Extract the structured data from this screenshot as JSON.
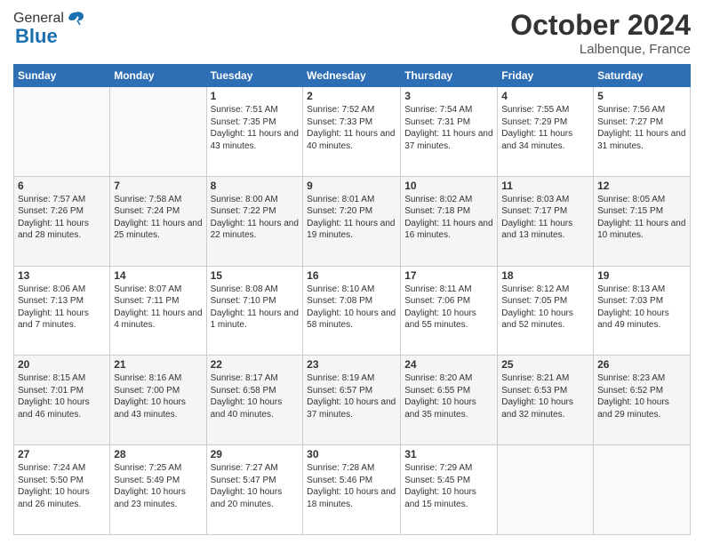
{
  "header": {
    "logo_general": "General",
    "logo_blue": "Blue",
    "month_title": "October 2024",
    "location": "Lalbenque, France"
  },
  "weekdays": [
    "Sunday",
    "Monday",
    "Tuesday",
    "Wednesday",
    "Thursday",
    "Friday",
    "Saturday"
  ],
  "weeks": [
    [
      {
        "day": "",
        "content": ""
      },
      {
        "day": "",
        "content": ""
      },
      {
        "day": "1",
        "content": "Sunrise: 7:51 AM\nSunset: 7:35 PM\nDaylight: 11 hours and 43 minutes."
      },
      {
        "day": "2",
        "content": "Sunrise: 7:52 AM\nSunset: 7:33 PM\nDaylight: 11 hours and 40 minutes."
      },
      {
        "day": "3",
        "content": "Sunrise: 7:54 AM\nSunset: 7:31 PM\nDaylight: 11 hours and 37 minutes."
      },
      {
        "day": "4",
        "content": "Sunrise: 7:55 AM\nSunset: 7:29 PM\nDaylight: 11 hours and 34 minutes."
      },
      {
        "day": "5",
        "content": "Sunrise: 7:56 AM\nSunset: 7:27 PM\nDaylight: 11 hours and 31 minutes."
      }
    ],
    [
      {
        "day": "6",
        "content": "Sunrise: 7:57 AM\nSunset: 7:26 PM\nDaylight: 11 hours and 28 minutes."
      },
      {
        "day": "7",
        "content": "Sunrise: 7:58 AM\nSunset: 7:24 PM\nDaylight: 11 hours and 25 minutes."
      },
      {
        "day": "8",
        "content": "Sunrise: 8:00 AM\nSunset: 7:22 PM\nDaylight: 11 hours and 22 minutes."
      },
      {
        "day": "9",
        "content": "Sunrise: 8:01 AM\nSunset: 7:20 PM\nDaylight: 11 hours and 19 minutes."
      },
      {
        "day": "10",
        "content": "Sunrise: 8:02 AM\nSunset: 7:18 PM\nDaylight: 11 hours and 16 minutes."
      },
      {
        "day": "11",
        "content": "Sunrise: 8:03 AM\nSunset: 7:17 PM\nDaylight: 11 hours and 13 minutes."
      },
      {
        "day": "12",
        "content": "Sunrise: 8:05 AM\nSunset: 7:15 PM\nDaylight: 11 hours and 10 minutes."
      }
    ],
    [
      {
        "day": "13",
        "content": "Sunrise: 8:06 AM\nSunset: 7:13 PM\nDaylight: 11 hours and 7 minutes."
      },
      {
        "day": "14",
        "content": "Sunrise: 8:07 AM\nSunset: 7:11 PM\nDaylight: 11 hours and 4 minutes."
      },
      {
        "day": "15",
        "content": "Sunrise: 8:08 AM\nSunset: 7:10 PM\nDaylight: 11 hours and 1 minute."
      },
      {
        "day": "16",
        "content": "Sunrise: 8:10 AM\nSunset: 7:08 PM\nDaylight: 10 hours and 58 minutes."
      },
      {
        "day": "17",
        "content": "Sunrise: 8:11 AM\nSunset: 7:06 PM\nDaylight: 10 hours and 55 minutes."
      },
      {
        "day": "18",
        "content": "Sunrise: 8:12 AM\nSunset: 7:05 PM\nDaylight: 10 hours and 52 minutes."
      },
      {
        "day": "19",
        "content": "Sunrise: 8:13 AM\nSunset: 7:03 PM\nDaylight: 10 hours and 49 minutes."
      }
    ],
    [
      {
        "day": "20",
        "content": "Sunrise: 8:15 AM\nSunset: 7:01 PM\nDaylight: 10 hours and 46 minutes."
      },
      {
        "day": "21",
        "content": "Sunrise: 8:16 AM\nSunset: 7:00 PM\nDaylight: 10 hours and 43 minutes."
      },
      {
        "day": "22",
        "content": "Sunrise: 8:17 AM\nSunset: 6:58 PM\nDaylight: 10 hours and 40 minutes."
      },
      {
        "day": "23",
        "content": "Sunrise: 8:19 AM\nSunset: 6:57 PM\nDaylight: 10 hours and 37 minutes."
      },
      {
        "day": "24",
        "content": "Sunrise: 8:20 AM\nSunset: 6:55 PM\nDaylight: 10 hours and 35 minutes."
      },
      {
        "day": "25",
        "content": "Sunrise: 8:21 AM\nSunset: 6:53 PM\nDaylight: 10 hours and 32 minutes."
      },
      {
        "day": "26",
        "content": "Sunrise: 8:23 AM\nSunset: 6:52 PM\nDaylight: 10 hours and 29 minutes."
      }
    ],
    [
      {
        "day": "27",
        "content": "Sunrise: 7:24 AM\nSunset: 5:50 PM\nDaylight: 10 hours and 26 minutes."
      },
      {
        "day": "28",
        "content": "Sunrise: 7:25 AM\nSunset: 5:49 PM\nDaylight: 10 hours and 23 minutes."
      },
      {
        "day": "29",
        "content": "Sunrise: 7:27 AM\nSunset: 5:47 PM\nDaylight: 10 hours and 20 minutes."
      },
      {
        "day": "30",
        "content": "Sunrise: 7:28 AM\nSunset: 5:46 PM\nDaylight: 10 hours and 18 minutes."
      },
      {
        "day": "31",
        "content": "Sunrise: 7:29 AM\nSunset: 5:45 PM\nDaylight: 10 hours and 15 minutes."
      },
      {
        "day": "",
        "content": ""
      },
      {
        "day": "",
        "content": ""
      }
    ]
  ]
}
